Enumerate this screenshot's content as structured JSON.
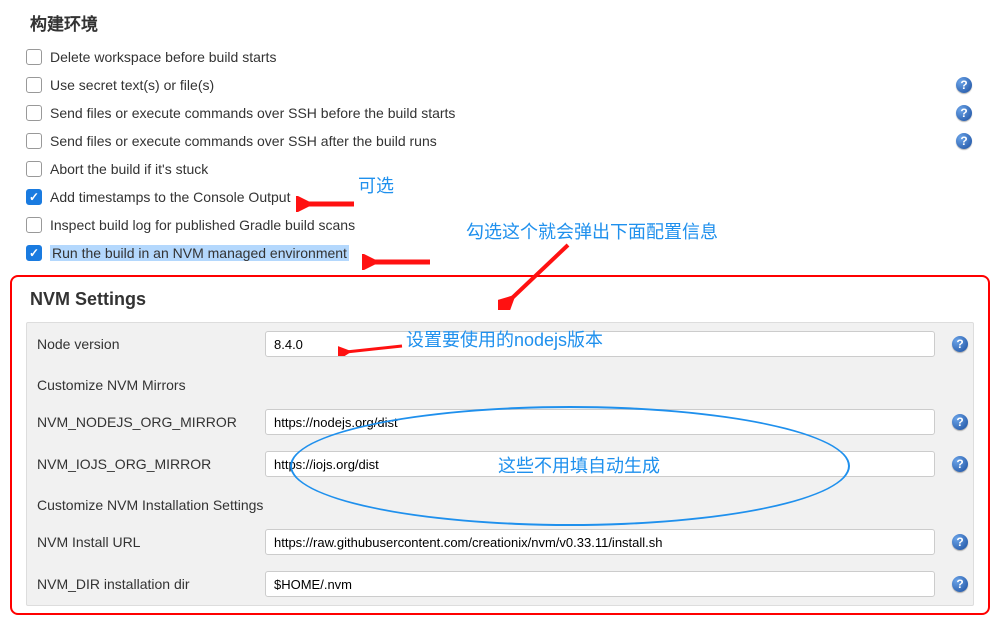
{
  "section_title": "构建环境",
  "options": [
    {
      "label": "Delete workspace before build starts",
      "checked": false,
      "help": false
    },
    {
      "label": "Use secret text(s) or file(s)",
      "checked": false,
      "help": true
    },
    {
      "label": "Send files or execute commands over SSH before the build starts",
      "checked": false,
      "help": true
    },
    {
      "label": "Send files or execute commands over SSH after the build runs",
      "checked": false,
      "help": true
    },
    {
      "label": "Abort the build if it's stuck",
      "checked": false,
      "help": false
    },
    {
      "label": "Add timestamps to the Console Output",
      "checked": true,
      "help": false
    },
    {
      "label": "Inspect build log for published Gradle build scans",
      "checked": false,
      "help": false
    },
    {
      "label": "Run the build in an NVM managed environment",
      "checked": true,
      "help": false,
      "highlight": true
    }
  ],
  "nvm": {
    "title": "NVM Settings",
    "node_version_label": "Node version",
    "node_version_value": "8.4.0",
    "mirrors_label": "Customize NVM Mirrors",
    "nodejs_mirror_label": "NVM_NODEJS_ORG_MIRROR",
    "nodejs_mirror_value": "https://nodejs.org/dist",
    "iojs_mirror_label": "NVM_IOJS_ORG_MIRROR",
    "iojs_mirror_value": "https://iojs.org/dist",
    "install_settings_label": "Customize NVM Installation Settings",
    "install_url_label": "NVM Install URL",
    "install_url_value": "https://raw.githubusercontent.com/creationix/nvm/v0.33.11/install.sh",
    "nvm_dir_label": "NVM_DIR installation dir",
    "nvm_dir_value": "$HOME/.nvm"
  },
  "annotations": {
    "optional": "可选",
    "check_prompt": "勾选这个就会弹出下面配置信息",
    "node_ver_prompt": "设置要使用的nodejs版本",
    "auto_gen_prompt": "这些不用填自动生成"
  }
}
